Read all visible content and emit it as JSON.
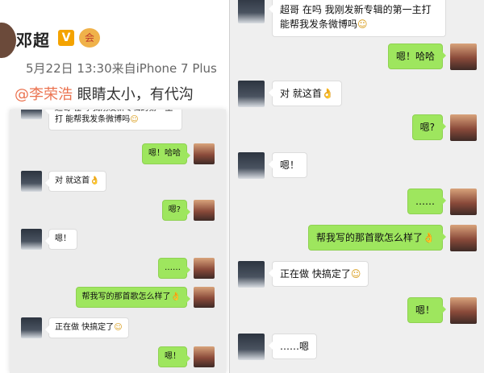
{
  "weibo": {
    "user_name": "邓超",
    "vip_label": "V",
    "badge_label": "会",
    "meta": "5月22日 13:30来自iPhone 7 Plus",
    "mention": "@李荣浩",
    "text": " 眼睛太小，有代沟"
  },
  "chat_big": {
    "messages": [
      {
        "side": "in",
        "text": "超哥 在吗 我刚发新专辑的第一主打 能帮我发条微博吗",
        "emoji": "☺"
      },
      {
        "side": "out",
        "text": "嗯！哈哈",
        "emoji": ""
      },
      {
        "side": "in",
        "text": "对 就这首",
        "emoji": "👌"
      },
      {
        "side": "out",
        "text": "嗯?",
        "emoji": ""
      },
      {
        "side": "in",
        "text": "嗯！",
        "emoji": ""
      },
      {
        "side": "out",
        "text": "……",
        "emoji": ""
      },
      {
        "side": "out",
        "text": "帮我写的那首歌怎么样了",
        "emoji": "👌"
      },
      {
        "side": "in",
        "text": "正在做 快搞定了",
        "emoji": "☺"
      },
      {
        "side": "out",
        "text": "嗯！",
        "emoji": ""
      },
      {
        "side": "in",
        "text": "……嗯",
        "emoji": ""
      }
    ]
  },
  "chat_small": {
    "messages": [
      {
        "side": "in",
        "text": "超哥 在吗 我刚发新专辑的第一主打 能帮我发条微博吗",
        "emoji": "☺"
      },
      {
        "side": "out",
        "text": "嗯！哈哈",
        "emoji": ""
      },
      {
        "side": "in",
        "text": "对 就这首",
        "emoji": "👌"
      },
      {
        "side": "out",
        "text": "嗯?",
        "emoji": ""
      },
      {
        "side": "in",
        "text": "嗯！",
        "emoji": ""
      },
      {
        "side": "out",
        "text": "……",
        "emoji": ""
      },
      {
        "side": "out",
        "text": "帮我写的那首歌怎么样了",
        "emoji": "👌"
      },
      {
        "side": "in",
        "text": "正在做 快搞定了",
        "emoji": "☺"
      },
      {
        "side": "out",
        "text": "嗯！",
        "emoji": ""
      }
    ]
  }
}
